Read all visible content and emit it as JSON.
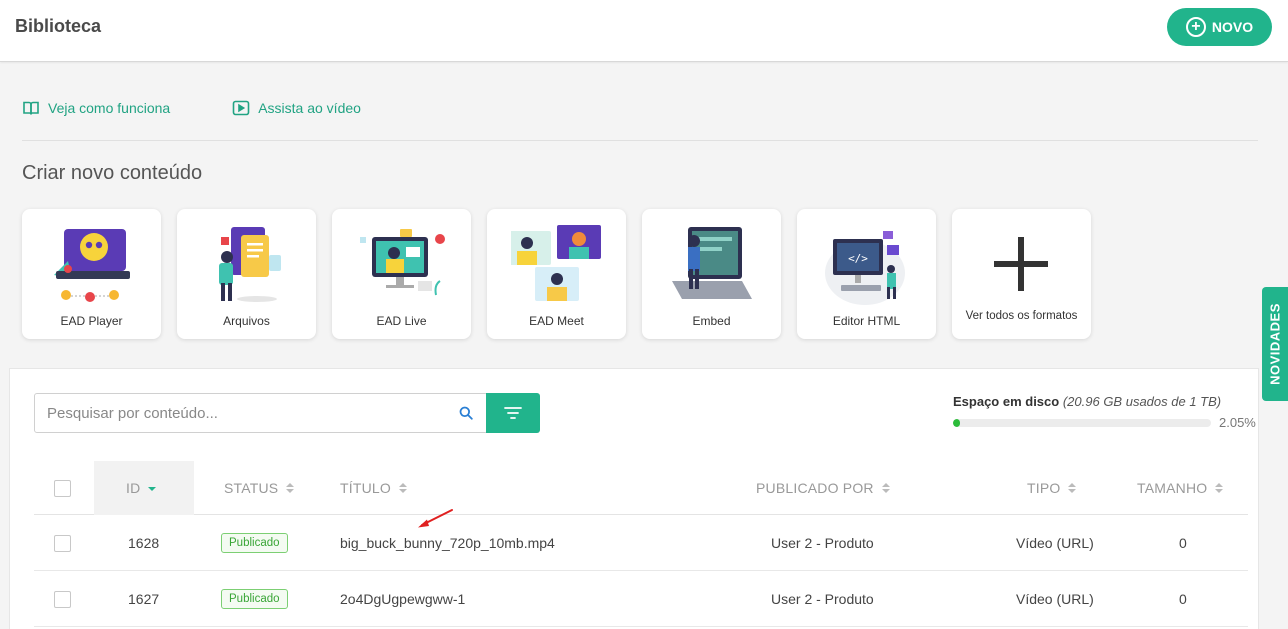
{
  "header": {
    "title": "Biblioteca",
    "new_button": "NOVO"
  },
  "links": [
    {
      "label": "Veja como funciona",
      "icon": "book-icon"
    },
    {
      "label": "Assista ao vídeo",
      "icon": "play-icon"
    }
  ],
  "create_section": {
    "title": "Criar novo conteúdo",
    "cards": [
      {
        "label": "EAD Player"
      },
      {
        "label": "Arquivos"
      },
      {
        "label": "EAD Live"
      },
      {
        "label": "EAD Meet"
      },
      {
        "label": "Embed"
      },
      {
        "label": "Editor HTML"
      },
      {
        "label": "Ver todos os formatos"
      }
    ]
  },
  "search": {
    "placeholder": "Pesquisar por conteúdo..."
  },
  "disk": {
    "label": "Espaço em disco",
    "usage": "(20.96 GB usados de 1 TB)",
    "percent_text": "2.05%",
    "percent": 0.0205
  },
  "table": {
    "columns": {
      "id": "ID",
      "status": "STATUS",
      "title": "TÍTULO",
      "published_by": "PUBLICADO POR",
      "type": "TIPO",
      "size": "TAMANHO"
    },
    "rows": [
      {
        "id": "1628",
        "status": "Publicado",
        "title": "big_buck_bunny_720p_10mb.mp4",
        "published_by": "User 2 - Produto",
        "type": "Vídeo (URL)",
        "size": "0"
      },
      {
        "id": "1627",
        "status": "Publicado",
        "title": "2o4DgUgpewgww-1",
        "published_by": "User 2 - Produto",
        "type": "Vídeo (URL)",
        "size": "0"
      }
    ]
  },
  "side_tab": {
    "label": "NOVIDADES"
  },
  "colors": {
    "accent": "#21b48c",
    "link": "#21a383",
    "published": "#3aa637",
    "disk_fill": "#2cbc3a",
    "annotation_arrow": "#e02020"
  }
}
